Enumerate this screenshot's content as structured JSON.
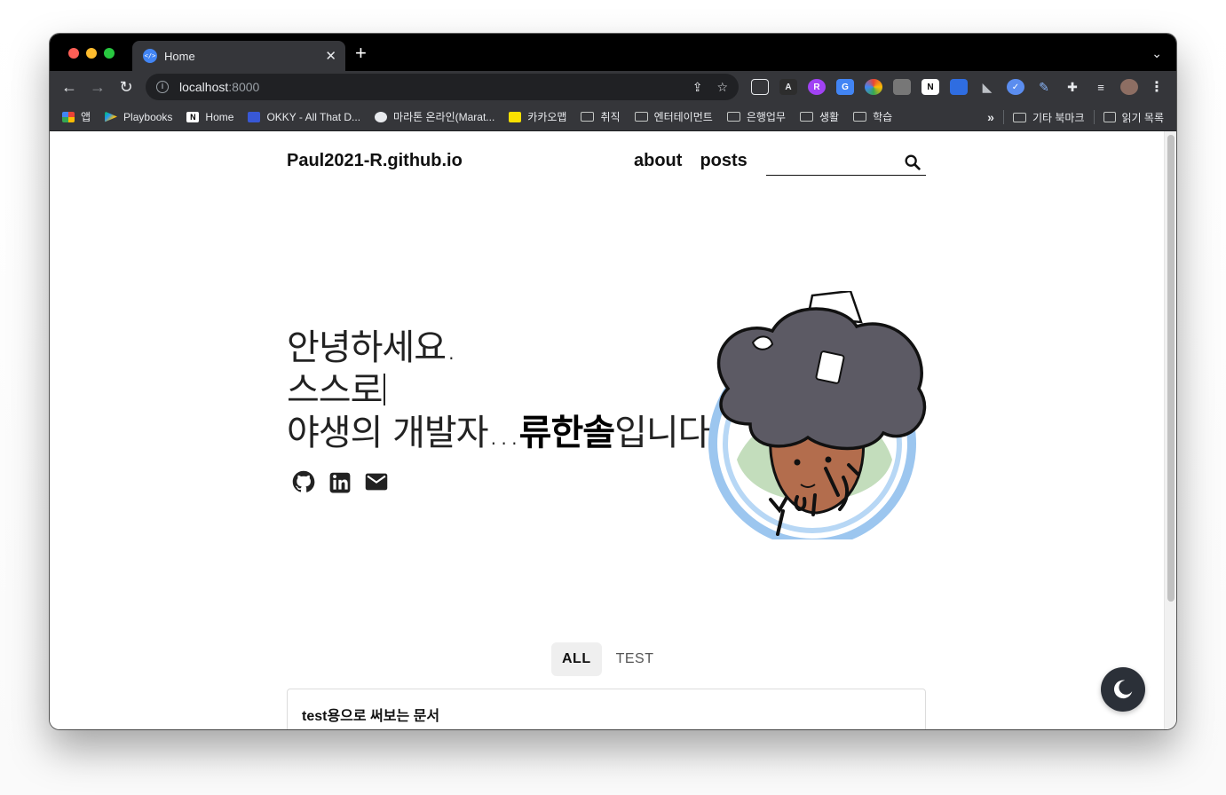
{
  "browser": {
    "tab_title": "Home",
    "tab_favicon": "</>",
    "url_host": "localhost",
    "url_port": ":8000",
    "info_glyph": "i",
    "bookmarks": [
      {
        "label": "앱",
        "icon": "apps-grid-icon"
      },
      {
        "label": "Playbooks",
        "icon": "play-store-icon"
      },
      {
        "label": "Home",
        "icon": "notion-icon"
      },
      {
        "label": "OKKY - All That D...",
        "icon": "okky-icon"
      },
      {
        "label": "마라톤 온라인(Marat...",
        "icon": "globe-icon"
      },
      {
        "label": "카카오맵",
        "icon": "kakaomap-icon"
      },
      {
        "label": "취직",
        "icon": "folder-icon"
      },
      {
        "label": "엔터테이먼트",
        "icon": "folder-icon"
      },
      {
        "label": "은행업무",
        "icon": "folder-icon"
      },
      {
        "label": "생활",
        "icon": "folder-icon"
      },
      {
        "label": "학습",
        "icon": "folder-icon"
      }
    ],
    "overflow_label": "»",
    "other_bookmarks": "기타 북마크",
    "reading_list": "읽기 목록"
  },
  "site": {
    "title": "Paul2021-R.github.io",
    "nav": [
      {
        "label": "about"
      },
      {
        "label": "posts"
      }
    ],
    "hero": {
      "line1": "안녕하세요.",
      "line2": "스스로",
      "line3_prefix": "야생의 개발자...",
      "line3_bold": "류한솔",
      "line3_suffix": "입니다."
    },
    "categories": [
      {
        "label": "ALL",
        "active": true
      },
      {
        "label": "TEST",
        "active": false
      }
    ],
    "posts": [
      {
        "title": "test용으로 써보는 문서"
      }
    ]
  },
  "colors": {
    "accent_dark": "#2b3038",
    "chrome_dark": "#35363a"
  }
}
